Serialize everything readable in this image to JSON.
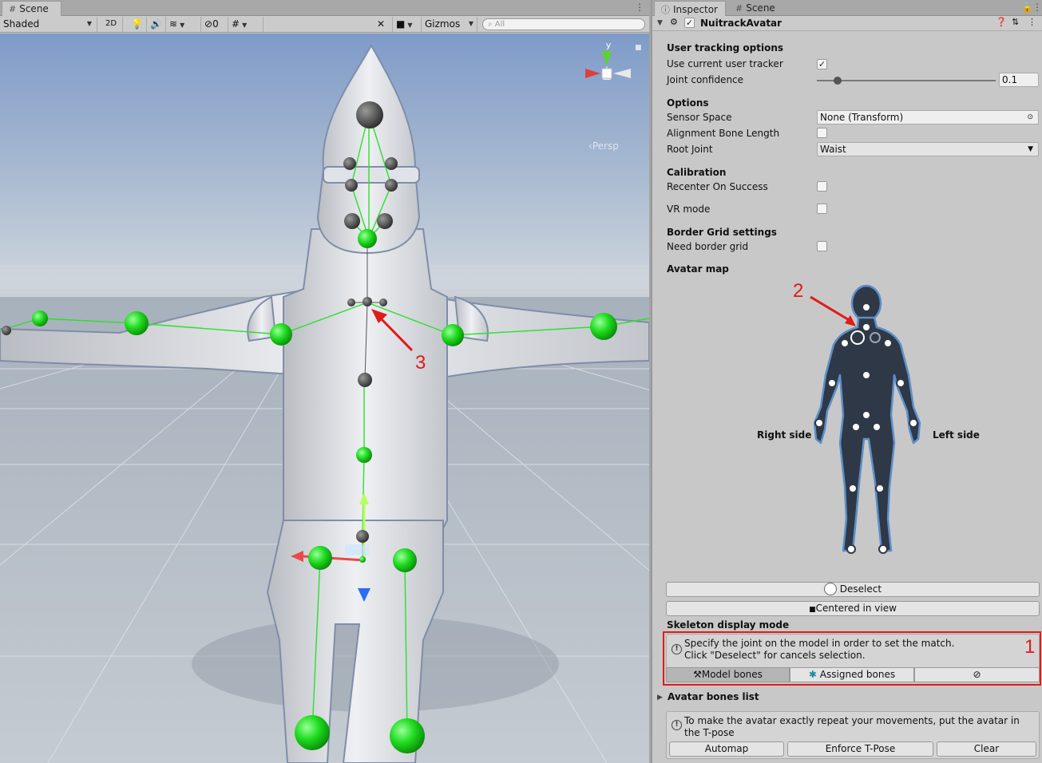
{
  "scene": {
    "tab_label": "Scene",
    "shading_mode": "Shaded",
    "mode_2d": "2D",
    "hidden_count": "0",
    "gizmos_label": "Gizmos",
    "search_placeholder": "All",
    "gizmo_axis_label": "y",
    "persp_label": "Persp",
    "annotation_label": "3"
  },
  "inspector": {
    "tabs": [
      "Inspector",
      "Scene"
    ],
    "component_title": "NuitrackAvatar",
    "component_enabled": true,
    "sections": {
      "user_tracking": {
        "title": "User tracking options",
        "use_current_user_tracker_label": "Use current user tracker",
        "use_current_user_tracker": true,
        "joint_confidence_label": "Joint confidence",
        "joint_confidence_value": "0.1",
        "joint_confidence_slider": 0.1
      },
      "options": {
        "title": "Options",
        "sensor_space_label": "Sensor Space",
        "sensor_space_value": "None (Transform)",
        "alignment_bone_length_label": "Alignment Bone Length",
        "alignment_bone_length": false,
        "root_joint_label": "Root Joint",
        "root_joint_value": "Waist"
      },
      "calibration": {
        "title": "Calibration",
        "recenter_label": "Recenter On Success",
        "recenter": false,
        "vr_mode_label": "VR mode",
        "vr_mode": false
      },
      "border_grid": {
        "title": "Border Grid settings",
        "need_border_grid_label": "Need border grid",
        "need_border_grid": false
      },
      "avatar_map": {
        "title": "Avatar map",
        "right_side_label": "Right side",
        "left_side_label": "Left side",
        "annotation_label": "2"
      }
    },
    "deselect_button": "Deselect",
    "centered_button": "Centered in view",
    "skeleton_display": {
      "title": "Skeleton display mode",
      "help_text_line1": "Specify the joint on the model in order to set the match.",
      "help_text_line2": "Click \"Deselect\" for cancels selection.",
      "model_bones_button": "Model bones",
      "assigned_bones_button": "Assigned bones",
      "hide_icon": "eye-slash-icon",
      "annotation_label": "1"
    },
    "avatar_bones_list": {
      "title": "Avatar bones list",
      "help_text": "To make the avatar exactly repeat your movements, put the avatar in the T-pose",
      "automap_button": "Automap",
      "enforce_tpose_button": "Enforce T-Pose",
      "clear_button": "Clear"
    }
  },
  "colors": {
    "annotation_red": "#e11a1a",
    "joint_green": "#1fdc1f",
    "silhouette_fill": "#2f3846",
    "silhouette_outline": "#5b8fc8"
  }
}
